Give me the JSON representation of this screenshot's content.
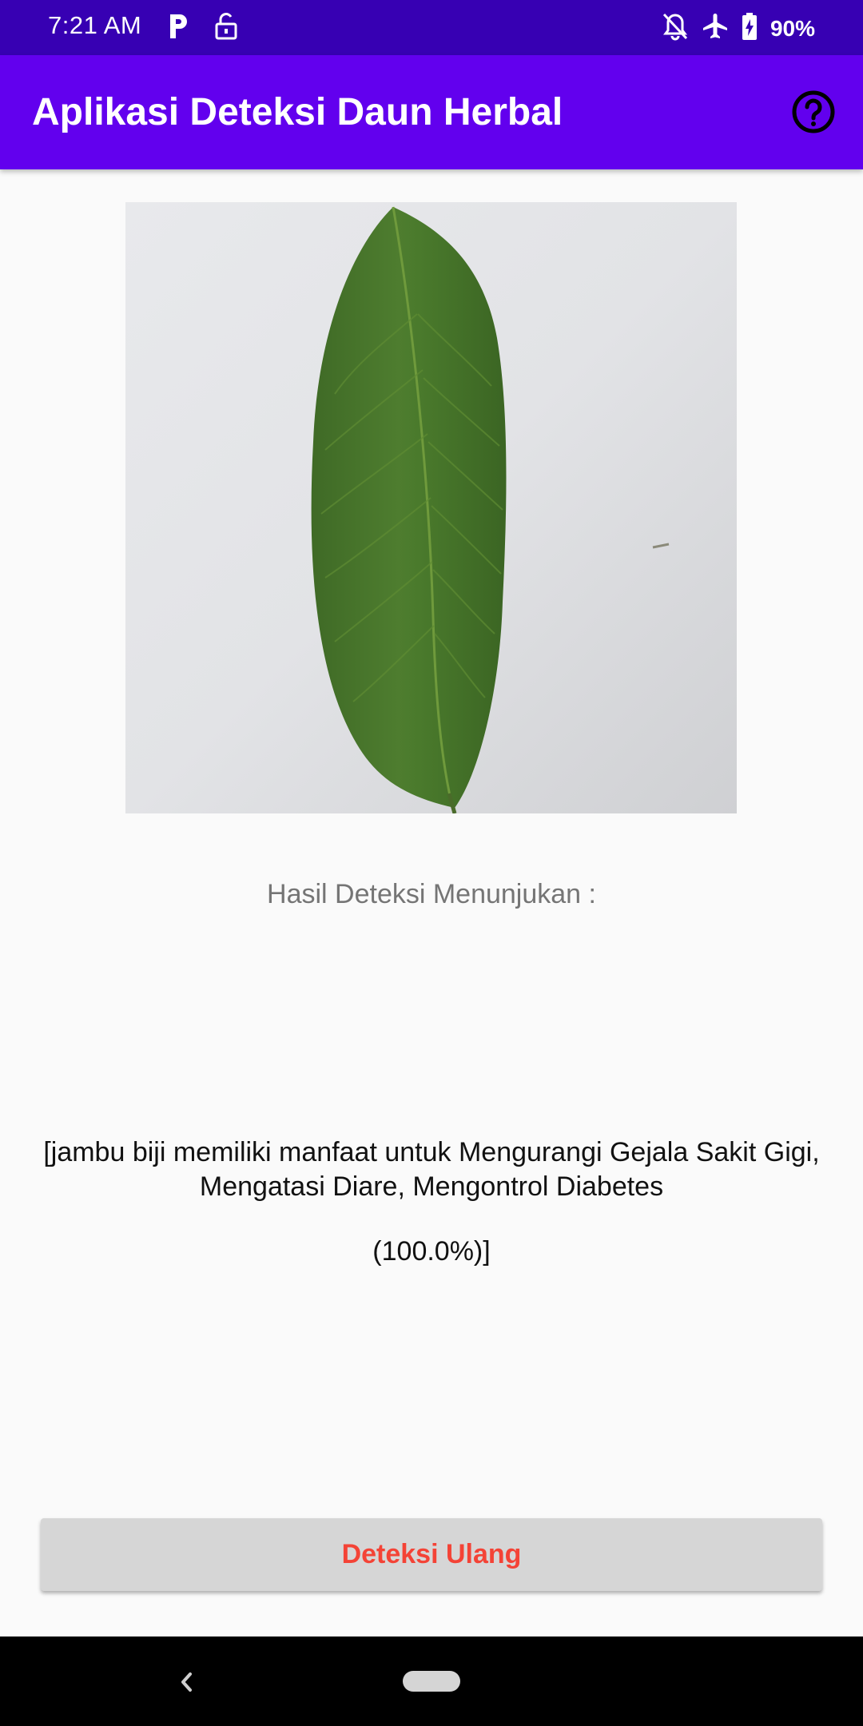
{
  "status_bar": {
    "time": "7:21 AM",
    "battery": "90%",
    "icons": [
      "p-notification-icon",
      "unlock-icon",
      "notifications-off-icon",
      "airplane-mode-icon",
      "battery-charging-icon"
    ]
  },
  "app_bar": {
    "title": "Aplikasi Deteksi Daun Herbal",
    "help_icon": "help-circle-icon"
  },
  "main": {
    "result_label": "Hasil Deteksi Menunjukan :",
    "result_text": "[jambu biji memiliki manfaat untuk Mengurangi Gejala Sakit Gigi, Mengatasi Diare, Mengontrol Diabetes",
    "result_percent": "(100.0%)]",
    "redetect_button": "Deteksi Ulang"
  },
  "colors": {
    "status_bar": "#3700b3",
    "app_bar": "#6200ee",
    "button_text": "#f44336",
    "button_bg": "#d6d6d6"
  }
}
